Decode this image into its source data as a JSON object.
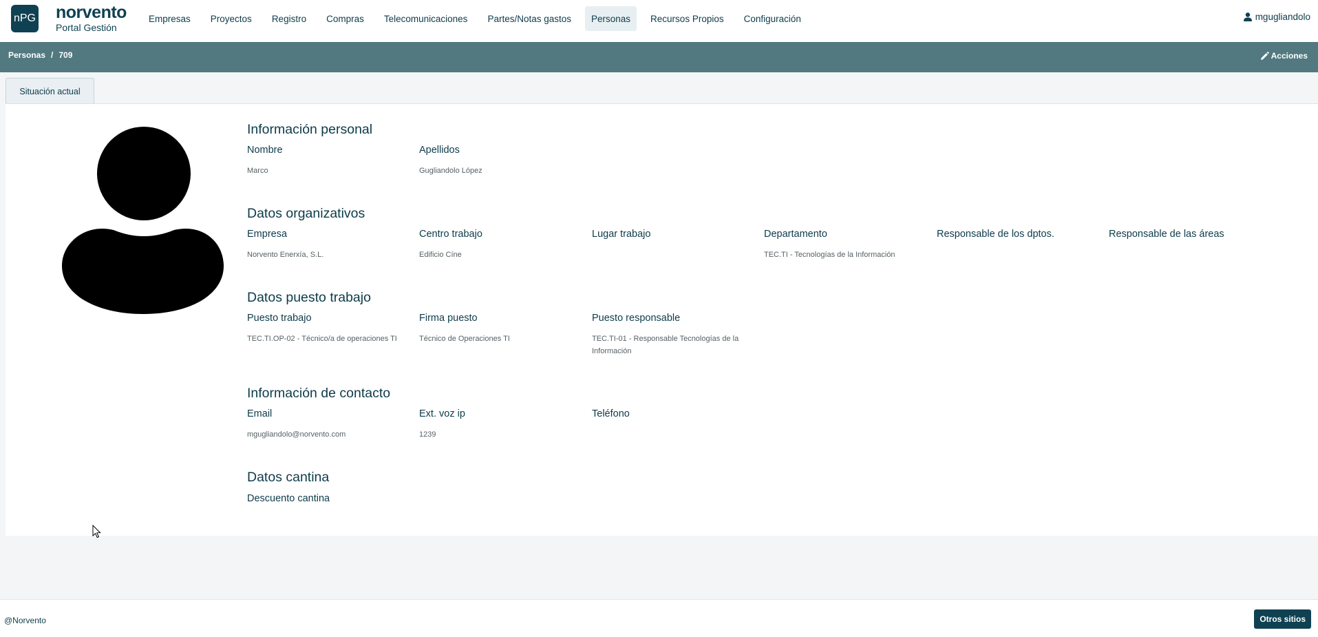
{
  "brand": {
    "logo": "nPG",
    "name": "norvento",
    "subtitle": "Portal Gestión"
  },
  "nav": {
    "items": [
      {
        "label": "Empresas"
      },
      {
        "label": "Proyectos"
      },
      {
        "label": "Registro"
      },
      {
        "label": "Compras"
      },
      {
        "label": "Telecomunicaciones"
      },
      {
        "label": "Partes/Notas gastos"
      },
      {
        "label": "Personas",
        "active": true
      },
      {
        "label": "Recursos Propios"
      },
      {
        "label": "Configuración"
      }
    ],
    "user": "mgugliandolo",
    "user_icon": "user-icon"
  },
  "breadcrumb": {
    "root": "Personas",
    "separator": "/",
    "current": "709"
  },
  "actions_label": "Acciones",
  "tabs": [
    {
      "label": "Situación actual"
    }
  ],
  "sections": {
    "personal": {
      "title": "Información personal",
      "nombre_label": "Nombre",
      "nombre_value": "Marco",
      "apellidos_label": "Apellidos",
      "apellidos_value": "Gugliandolo López"
    },
    "organizativos": {
      "title": "Datos organizativos",
      "empresa_label": "Empresa",
      "empresa_value": "Norvento Enerxía, S.L.",
      "centro_label": "Centro trabajo",
      "centro_value": "Edificio Cíne",
      "lugar_label": "Lugar trabajo",
      "departamento_label": "Departamento",
      "departamento_value": "TEC.TI - Tecnologías de la Información",
      "resp_dptos_label": "Responsable de los dptos.",
      "resp_areas_label": "Responsable de las áreas"
    },
    "puesto": {
      "title": "Datos puesto trabajo",
      "puesto_label": "Puesto trabajo",
      "puesto_value": "TEC.TI.OP-02 - Técnico/a de operaciones TI",
      "firma_label": "Firma puesto",
      "firma_value": "Técnico de Operaciones TI",
      "responsable_label": "Puesto responsable",
      "responsable_value": "TEC.TI-01 - Responsable Tecnologías de la Información"
    },
    "contacto": {
      "title": "Información de contacto",
      "email_label": "Email",
      "email_value": "mgugliandolo@norvento.com",
      "ext_label": "Ext. voz ip",
      "ext_value": "1239",
      "telefono_label": "Teléfono"
    },
    "cantina": {
      "title": "Datos cantina",
      "descuento_label": "Descuento cantina"
    }
  },
  "footer": {
    "copyright": "@Norvento",
    "other_sites": "Otros sitios"
  },
  "colors": {
    "primary": "#0f4152",
    "breadcrumb_bar": "#51797f",
    "page_bg": "#f3f5f7"
  }
}
